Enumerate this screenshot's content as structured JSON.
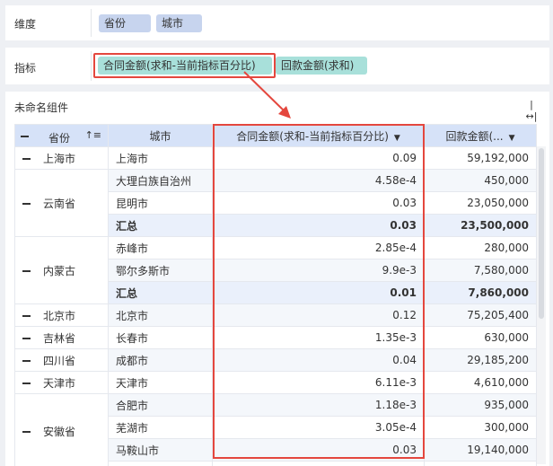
{
  "dimension": {
    "label": "维度",
    "pills": [
      "省份",
      "城市"
    ]
  },
  "metric": {
    "label": "指标",
    "pills": [
      "合同金额(求和-当前指标百分比)",
      "回款金额(求和)"
    ]
  },
  "widget": {
    "title": "未命名组件",
    "columns": {
      "province": "省份",
      "city": "城市",
      "contract": "合同金额(求和-当前指标百分比)",
      "payment": "回款金额(..."
    },
    "rows": [
      {
        "province": "上海市",
        "city": "上海市",
        "contract": "0.09",
        "payment": "59,192,000"
      },
      {
        "province": "云南省",
        "city": "大理白族自治州",
        "contract": "4.58e-4",
        "payment": "450,000"
      },
      {
        "province": "",
        "city": "昆明市",
        "contract": "0.03",
        "payment": "23,050,000"
      },
      {
        "province": "",
        "city": "汇总",
        "contract": "0.03",
        "payment": "23,500,000",
        "subtotal": true
      },
      {
        "province": "内蒙古",
        "city": "赤峰市",
        "contract": "2.85e-4",
        "payment": "280,000"
      },
      {
        "province": "",
        "city": "鄂尔多斯市",
        "contract": "9.9e-3",
        "payment": "7,580,000"
      },
      {
        "province": "",
        "city": "汇总",
        "contract": "0.01",
        "payment": "7,860,000",
        "subtotal": true
      },
      {
        "province": "北京市",
        "city": "北京市",
        "contract": "0.12",
        "payment": "75,205,400"
      },
      {
        "province": "吉林省",
        "city": "长春市",
        "contract": "1.35e-3",
        "payment": "630,000"
      },
      {
        "province": "四川省",
        "city": "成都市",
        "contract": "0.04",
        "payment": "29,185,200"
      },
      {
        "province": "天津市",
        "city": "天津市",
        "contract": "6.11e-3",
        "payment": "4,610,000"
      },
      {
        "province": "安徽省",
        "city": "合肥市",
        "contract": "1.18e-3",
        "payment": "935,000"
      },
      {
        "province": "",
        "city": "芜湖市",
        "contract": "3.05e-4",
        "payment": "300,000"
      },
      {
        "province": "",
        "city": "马鞍山市",
        "contract": "0.03",
        "payment": "19,140,000"
      }
    ]
  },
  "colors": {
    "highlight": "#e4473e",
    "header": "#d6e2f8",
    "dim_pill": "#c7d4ee",
    "metric_pill": "#a8e0da"
  }
}
